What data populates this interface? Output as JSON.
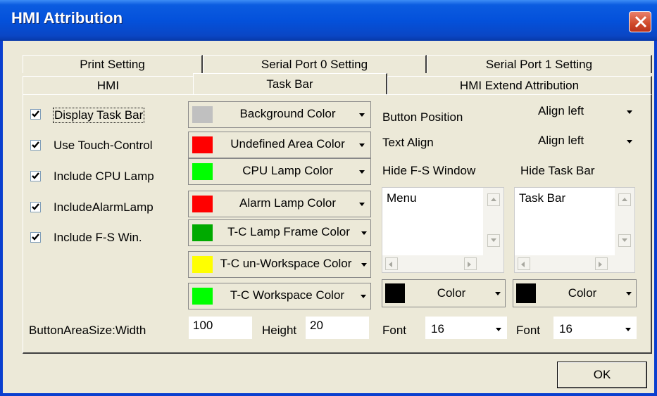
{
  "window": {
    "title": "HMI Attribution"
  },
  "tabs_back": [
    "Print Setting",
    "Serial Port 0 Setting",
    "Serial Port 1 Setting"
  ],
  "tabs_front": [
    "HMI",
    "Task Bar",
    "HMI Extend Attribution"
  ],
  "active_tab": "Task Bar",
  "checkboxes": [
    {
      "label": "Display Task Bar",
      "checked": true
    },
    {
      "label": "Use Touch-Control",
      "checked": true
    },
    {
      "label": "Include CPU Lamp",
      "checked": true
    },
    {
      "label": "IncludeAlarmLamp",
      "checked": true
    },
    {
      "label": "Include F-S Win.",
      "checked": true
    }
  ],
  "color_buttons": [
    {
      "label": "Background Color",
      "color": "#c0c0c0"
    },
    {
      "label": "Undefined Area Color",
      "color": "#ff0000"
    },
    {
      "label": "CPU Lamp Color",
      "color": "#00ff00"
    },
    {
      "label": "Alarm Lamp Color",
      "color": "#ff0000"
    },
    {
      "label": "T-C Lamp Frame Color",
      "color": "#00aa00"
    },
    {
      "label": "T-C un-Workspace Color",
      "color": "#ffff00"
    },
    {
      "label": "T-C Workspace Color",
      "color": "#00ff00"
    }
  ],
  "button_position": {
    "label": "Button Position",
    "value": "Align left"
  },
  "text_align": {
    "label": "Text Align",
    "value": "Align left"
  },
  "hide_fs": {
    "label": "Hide F-S Window",
    "item": "Menu",
    "color_label": "Color",
    "swatch": "#000000",
    "font_label": "Font",
    "font_value": "16"
  },
  "hide_task": {
    "label": "Hide Task Bar",
    "item": "Task Bar",
    "color_label": "Color",
    "swatch": "#000000",
    "font_label": "Font",
    "font_value": "16"
  },
  "button_area": {
    "label": "ButtonAreaSize:Width",
    "width": "100",
    "height_label": "Height",
    "height": "20"
  },
  "ok_label": "OK",
  "theme": {
    "title_blue": "#0451db",
    "face": "#ece9d8"
  }
}
